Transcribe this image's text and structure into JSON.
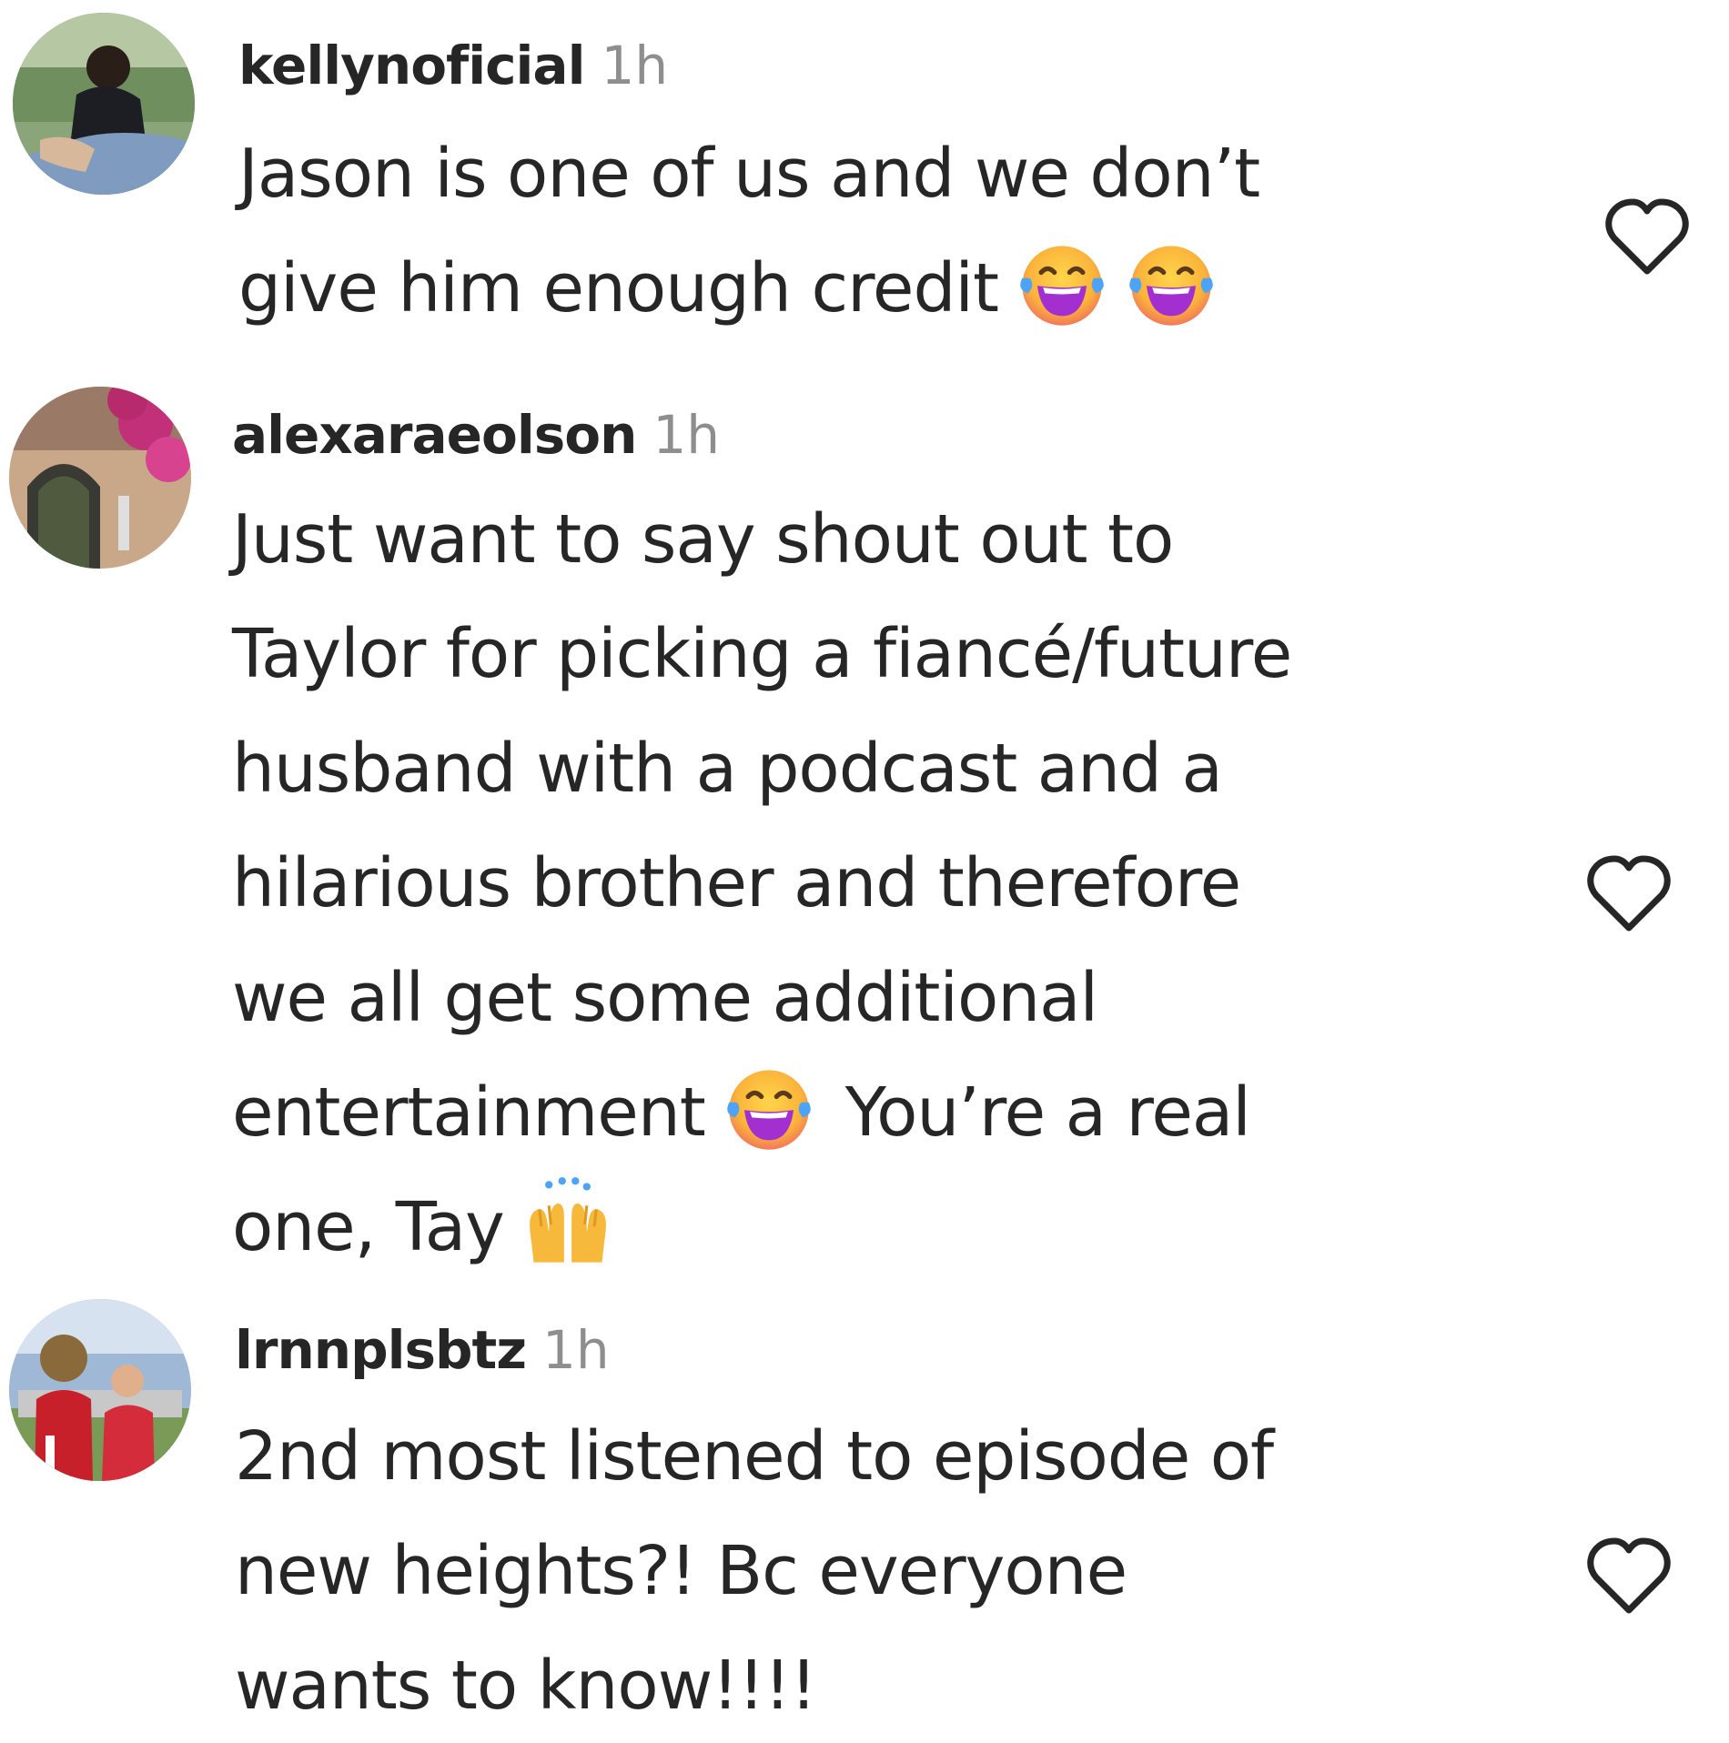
{
  "comments": [
    {
      "username": "kellynoficial",
      "time": "1h",
      "lines": [
        "Jason is one of us and we don’t",
        "give him enough credit"
      ],
      "emojis": [
        "face-with-tears-of-joy-icon",
        "face-with-tears-of-joy-icon"
      ]
    },
    {
      "username": "alexaraeolson",
      "time": "1h",
      "lines": [
        "Just want to say shout out to",
        "Taylor for picking a fiancé/future",
        "husband with a podcast and a",
        "hilarious brother and therefore",
        "we all get some additional",
        "entertainment",
        "You’re a real",
        "one, Tay"
      ],
      "emojis": [
        "face-with-tears-of-joy-icon",
        "raising-hands-icon"
      ]
    },
    {
      "username": "lrnnplsbtz",
      "time": "1h",
      "lines": [
        "2nd most listened to episode of",
        "new heights?! Bc everyone",
        "wants to know!!!!"
      ]
    }
  ],
  "colors": {
    "text": "#262626",
    "muted": "#8e8e8e",
    "emoji_face": "#f9b233",
    "emoji_tears": "#5aa9f0",
    "emoji_mouth": "#9b2fc9"
  }
}
